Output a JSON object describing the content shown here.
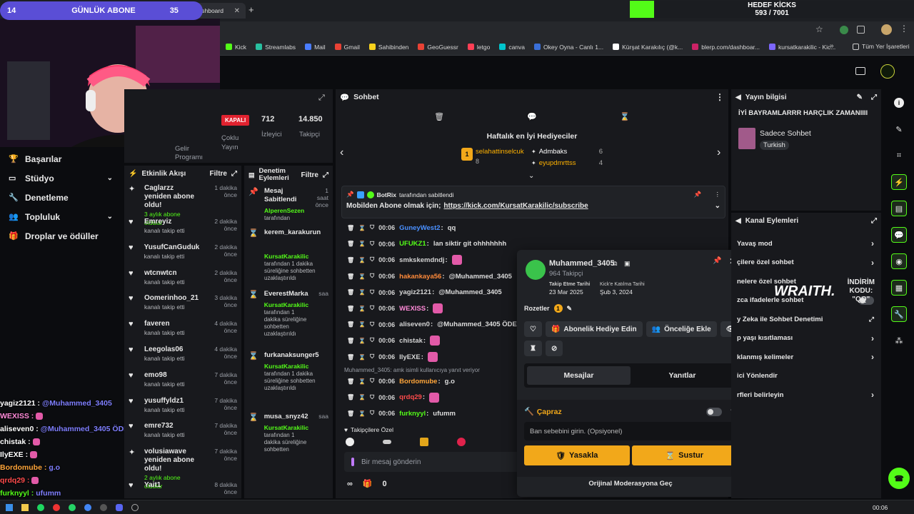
{
  "overlay": {
    "sub_count": "14",
    "sub_label": "GÜNLÜK ABONE",
    "sub_target": "35",
    "goal_title": "HEDEF KİCKS",
    "goal_value": "593 / 7001",
    "goal_progress": 0.085
  },
  "browser": {
    "tab_title": "Stream - Kick Dashboard",
    "bookmarks": [
      "Kick",
      "Streamlabs",
      "Mail",
      "Gmail",
      "Sahibinden",
      "GeoGuessr",
      "letgo",
      "canva",
      "Okey Oyna - Canlı 1...",
      "Kürşat Karakılıç (@k...",
      "blerp.com/dashboar...",
      "kursatkarakilic - Kic..."
    ],
    "all_bookmarks": "Tüm Yer İşaretleri",
    "bookmark_colors": [
      "#53fc18",
      "#28c0a0",
      "#4a7dff",
      "#e94235",
      "#f7d21d",
      "#e94235",
      "#ff3f55",
      "#00c4cc",
      "#3a6fd8",
      "#ffffff",
      "#cc2266",
      "#7c66ff"
    ]
  },
  "leftnav": {
    "items": [
      {
        "label": "Başarılar",
        "icon": "trophy-icon",
        "chevron": false
      },
      {
        "label": "Stüdyo",
        "icon": "studio-icon",
        "chevron": true
      },
      {
        "label": "Denetleme",
        "icon": "wrench-icon",
        "chevron": false
      },
      {
        "label": "Topluluk",
        "icon": "community-icon",
        "chevron": true
      },
      {
        "label": "Droplar ve ödüller",
        "icon": "gift-icon",
        "chevron": false
      }
    ]
  },
  "overlay_chat": [
    {
      "user": "yagiz2121 :",
      "msg": "@Muhammed_3405",
      "color": "#ffffff"
    },
    {
      "user": "WEXISS :",
      "msg": "",
      "color": "#ff8ad8"
    },
    {
      "user": "aliseven0 :",
      "msg": "@Muhammed_3405 ÖDE",
      "color": "#ffffff"
    },
    {
      "user": "chistak :",
      "msg": "",
      "color": "#ffffff"
    },
    {
      "user": "IlyEXE :",
      "msg": "",
      "color": "#ffffff"
    },
    {
      "user": "Bordomube :",
      "msg": "g.o",
      "color": "#ffa53a"
    },
    {
      "user": "qrdq29 :",
      "msg": "",
      "color": "#ff4b4b"
    },
    {
      "user": "furknyyl :",
      "msg": "ufumm",
      "color": "#53fc18"
    }
  ],
  "stats": {
    "status": "KAPALI",
    "viewers_value": "712",
    "viewers_label": "İzleyici",
    "followers_value": "14.850",
    "followers_label": "Takipçi",
    "chat_label_1": "Çoklu",
    "chat_label_2": "Yayın",
    "income_label_1": "Gelir",
    "income_label_2": "Programı"
  },
  "activity": {
    "title": "Etkinlik Akışı",
    "filter": "Filtre",
    "items": [
      {
        "icon": "sparkle-icon",
        "name": "Caglarzz yeniden abone oldu!",
        "sub": "3 aylık abone oldular",
        "sub_green": true,
        "time": "1 dakika önce"
      },
      {
        "icon": "heart-icon",
        "name": "Emreyiz",
        "sub": "kanalı takip etti",
        "time": "2 dakika önce"
      },
      {
        "icon": "heart-icon",
        "name": "YusufCanGuduk",
        "sub": "kanalı takip etti",
        "time": "2 dakika önce"
      },
      {
        "icon": "heart-icon",
        "name": "wtcnwtcn",
        "sub": "kanalı takip etti",
        "time": "2 dakika önce"
      },
      {
        "icon": "heart-icon",
        "name": "Oomerinhoo_21",
        "sub": "kanalı takip etti",
        "time": "3 dakika önce"
      },
      {
        "icon": "heart-icon",
        "name": "faveren",
        "sub": "kanalı takip etti",
        "time": "4 dakika önce"
      },
      {
        "icon": "heart-icon",
        "name": "Leegolas06",
        "sub": "kanalı takip etti",
        "time": "4 dakika önce"
      },
      {
        "icon": "heart-icon",
        "name": "emo98",
        "sub": "kanalı takip etti",
        "time": "7 dakika önce"
      },
      {
        "icon": "heart-icon",
        "name": "yusuffyldz1",
        "sub": "kanalı takip etti",
        "time": "7 dakika önce"
      },
      {
        "icon": "heart-icon",
        "name": "emre732",
        "sub": "kanalı takip etti",
        "time": "7 dakika önce"
      },
      {
        "icon": "sparkle-icon",
        "name": "volusiawave yeniden abone oldu!",
        "sub": "2 aylık abone oldular",
        "sub_green": true,
        "time": "7 dakika önce"
      },
      {
        "icon": "heart-icon",
        "name": "Yait1",
        "sub": "",
        "time": "8 dakika önce"
      }
    ]
  },
  "modlog": {
    "title_1": "Denetim",
    "title_2": "Eylemleri",
    "filter": "Filtre",
    "items": [
      {
        "icon": "pin-icon",
        "title": "Mesaj Sabitlendi",
        "by": "AlperenSezen",
        "by_suffix": "tarafından",
        "time": "1 saat önce"
      },
      {
        "icon": "hourglass-icon",
        "title": "kerem_karakurun",
        "by": "",
        "by_suffix": "",
        "time": ""
      },
      {
        "icon": "",
        "title": "",
        "by": "KursatKarakilic",
        "by_suffix": "tarafından 1 dakika süreliğine sohbetten uzaklaştırıldı",
        "time": ""
      },
      {
        "icon": "hourglass-icon",
        "title": "EverestMarka",
        "by": "KursatKarakilic",
        "by_suffix": "tarafından 1 dakika süreliğine sohbetten uzaklaştırıldı",
        "time": "saa"
      },
      {
        "icon": "hourglass-icon",
        "title": "furkanaksunger5",
        "by": "KursatKarakilic",
        "by_suffix": "tarafından 1 dakika süreliğine sohbetten uzaklaştırıldı",
        "time": ""
      },
      {
        "icon": "hourglass-icon",
        "title": "musa_snyz42",
        "by": "KursatKarakilic",
        "by_suffix": "tarafından 1 dakika süreliğine sohbetten",
        "time": "saa"
      }
    ]
  },
  "chat": {
    "title": "Sohbet",
    "gifters_title": "Haftalık en İyi Hediyeciler",
    "gifters": [
      {
        "name": "selahattinselcuk",
        "count": "8",
        "color": "#ffb200"
      },
      {
        "name": "Admbaks",
        "count": "6",
        "color": "#ffffff"
      },
      {
        "name": "eyupdmrttss",
        "count": "4",
        "color": "#ffb200"
      }
    ],
    "pinned_by": "BotRix",
    "pinned_by_suffix": "tarafından sabitlendi",
    "pinned_text": "Mobilden Abone olmak için;",
    "pinned_link": "https://kick.com/KursatKarakilic/subscribe",
    "messages": [
      {
        "time": "00:06",
        "user": "GuneyWest2",
        "color": "#4a90ff",
        "text": "qq",
        "emote": false
      },
      {
        "time": "00:06",
        "user": "UFUKZ1",
        "color": "#53fc18",
        "text": "lan siktir git ohhhhhhh",
        "emote": false
      },
      {
        "time": "00:06",
        "user": "smkskemdndj",
        "color": "#d4d4d4",
        "text": "",
        "emote": true
      },
      {
        "time": "00:06",
        "user": "hakankaya56",
        "color": "#ff8a3a",
        "text": "@Muhammed_3405",
        "emote": false
      },
      {
        "time": "00:06",
        "user": "yagiz2121",
        "color": "#d4d4d4",
        "text": "@Muhammed_3405",
        "emote": false
      },
      {
        "time": "00:06",
        "user": "WEXISS",
        "color": "#ff8ad8",
        "text": "",
        "emote": true
      },
      {
        "time": "00:06",
        "user": "aliseven0",
        "color": "#d4d4d4",
        "text": "@Muhammed_3405 ÖDE",
        "emote": false
      },
      {
        "time": "00:06",
        "user": "chistak",
        "color": "#d4d4d4",
        "text": "",
        "emote": true
      },
      {
        "time": "00:06",
        "user": "IlyEXE",
        "color": "#d4d4d4",
        "text": "",
        "emote": true
      }
    ],
    "reply_note": "Muhammed_3405: amk isimli kullanıcıya yanıt veriyor",
    "messages2": [
      {
        "time": "00:06",
        "user": "Bordomube",
        "color": "#ffa53a",
        "text": "g.o",
        "emote": false
      },
      {
        "time": "00:06",
        "user": "qrdq29",
        "color": "#ff4b4b",
        "text": "",
        "emote": true
      },
      {
        "time": "00:06",
        "user": "furknyyl",
        "color": "#53fc18",
        "text": "ufumm",
        "emote": false
      }
    ],
    "follower_only": "Takipçilere Özel",
    "input_placeholder": "Bir mesaj gönderin",
    "bottom_count": "0"
  },
  "usercard": {
    "username": "Muhammed_3405",
    "followers": "964 Takipçi",
    "follow_date_label": "Takip Etme Tarihi",
    "follow_date": "23 Mar 2025",
    "join_date_label": "Kick'e Katılma Tarihi",
    "join_date": "Şub 3, 2024",
    "badges_label": "Rozetler",
    "gift_sub": "Abonelik Hediye Edin",
    "priority_add": "Önceliğe Ekle",
    "tab_messages": "Mesajlar",
    "tab_replies": "Yanıtlar",
    "cross_label": "Çapraz",
    "ban_placeholder": "Ban sebebini girin. (Opsiyonel)",
    "ban_button": "Yasakla",
    "timeout_button": "Sustur",
    "original_mod": "Orijinal Moderasyona Geç"
  },
  "streaminfo": {
    "title": "Yayın bilgisi",
    "stream_title": "İYİ BAYRAMLARRR HARÇLIK ZAMANIIII",
    "category": "Sadece Sohbet",
    "language": "Turkish"
  },
  "chanactions": {
    "title": "Kanal Eylemleri",
    "items": [
      {
        "label": "Yavaş mod",
        "extra": "",
        "control": "chevron"
      },
      {
        "label": "çilere özel sohbet",
        "extra": "",
        "control": "chevron"
      },
      {
        "label": "nelere özel sohbet",
        "extra": "",
        "control": "none"
      },
      {
        "label": "zca ifadelerle sohbet",
        "extra": "",
        "control": "toggle"
      },
      {
        "label": "y Zeka ile Sohbet Denetimi",
        "extra": "",
        "control": "external"
      },
      {
        "label": "p yaşı kısıtlaması",
        "extra": "",
        "control": "chevron"
      },
      {
        "label": "klanmış kelimeler",
        "extra": "",
        "control": "chevron"
      },
      {
        "label": "ici Yönlendir",
        "extra": "",
        "control": "none"
      },
      {
        "label": "rfleri belirleyin",
        "extra": "",
        "control": "chevron"
      }
    ],
    "wraith": "WRAITH.",
    "discount_label": "İNDİRİM KODU:",
    "discount_code": "\"QQ\""
  },
  "taskbar": {
    "time": "00:06"
  }
}
